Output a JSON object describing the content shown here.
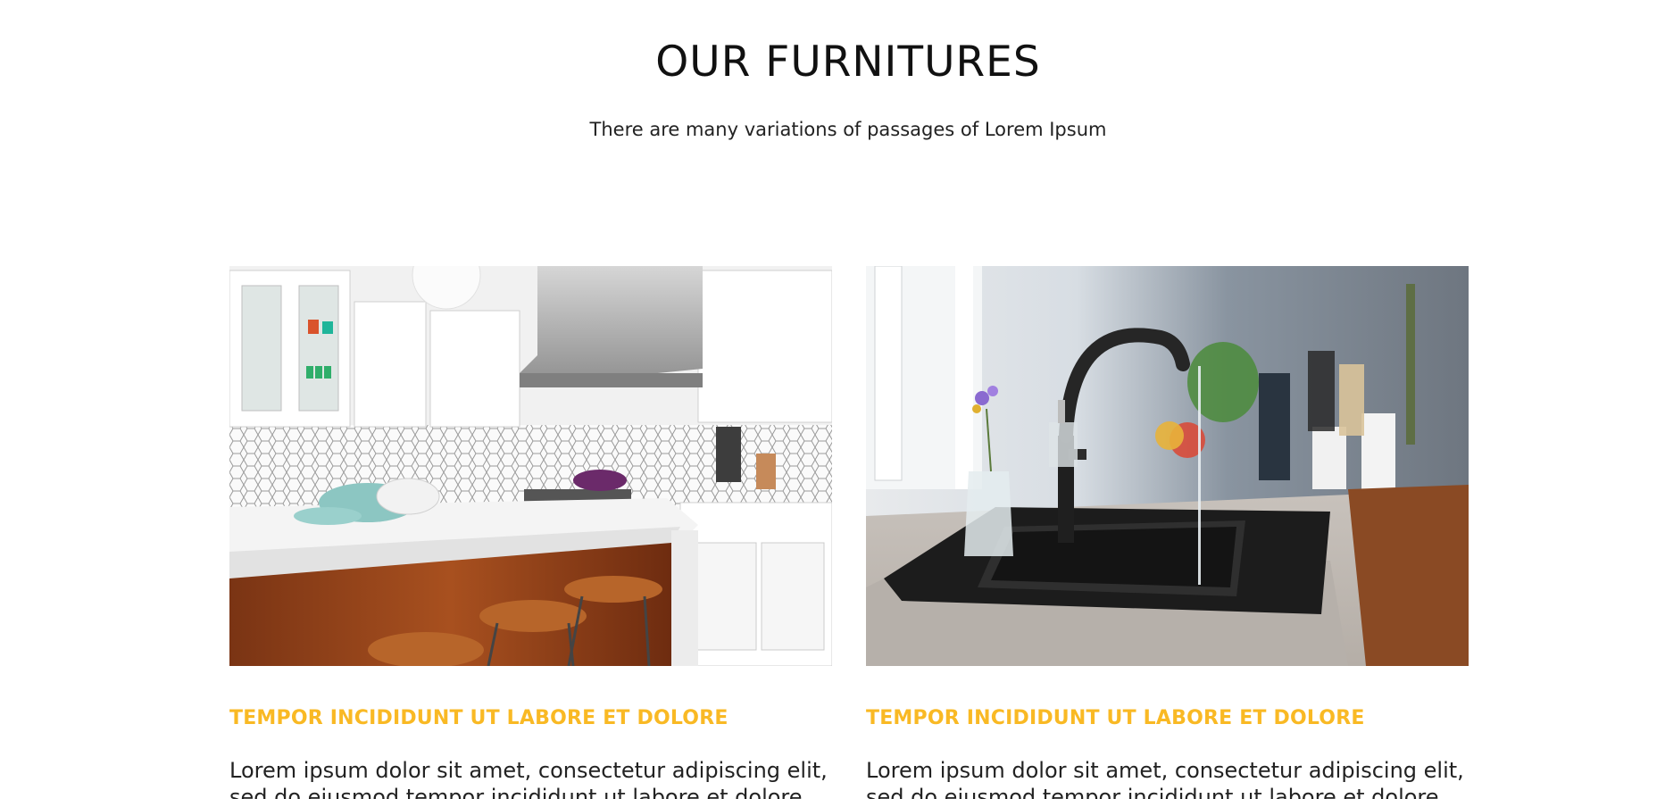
{
  "section": {
    "title": "OUR FURNITURES",
    "subtitle": "There are many variations of passages of Lorem Ipsum"
  },
  "cards": [
    {
      "image": "kitchen-photo",
      "heading": "TEMPOR INCIDIDUNT UT LABORE ET DOLORE",
      "text": "Lorem ipsum dolor sit amet, consectetur adipiscing elit, sed do eiusmod tempor incididunt ut labore et dolore magna"
    },
    {
      "image": "sink-photo",
      "heading": "TEMPOR INCIDIDUNT UT LABORE ET DOLORE",
      "text": "Lorem ipsum dolor sit amet, consectetur adipiscing elit, sed do eiusmod tempor incididunt ut labore et dolore magna"
    }
  ],
  "colors": {
    "accent": "#f9b924",
    "text": "#222222",
    "background": "#ffffff"
  }
}
